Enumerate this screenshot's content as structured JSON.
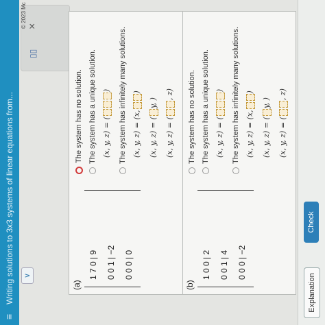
{
  "header": {
    "menu_icon": "hamburger-icon",
    "title": "Writing solutions to 3x3 systems of linear equations from..."
  },
  "chevron_label": "∨",
  "toolbar": {
    "grid_icon": "▯▯",
    "close": "×"
  },
  "copyright": "© 2023 Mc",
  "part_a": {
    "label": "(a)",
    "matrix_rows": [
      "1  7  0  |  9",
      "0  0  1  |  −2",
      "0  0  0  |  0"
    ],
    "options": [
      {
        "text": "The system has no solution.",
        "selected": true
      },
      {
        "text": "The system has a unique solution.",
        "selected": false
      },
      {
        "text": "The system has infinitely many solutions.",
        "selected": false
      }
    ],
    "unique_expr": "(x, y, z) = (",
    "infinite_exprs": [
      "(x, y, z) = (x,",
      "(x, y, z) = (",
      "(x, y, z) = ("
    ],
    "infinite_tails": [
      ")",
      "y, )",
      ", z)"
    ]
  },
  "part_b": {
    "label": "(b)",
    "matrix_rows": [
      "1  0  0  |  2",
      "0  0  1  |  4",
      "0  0  0  |  −2"
    ],
    "options": [
      {
        "text": "The system has no solution.",
        "selected": false
      },
      {
        "text": "The system has a unique solution.",
        "selected": false
      },
      {
        "text": "The system has infinitely many solutions.",
        "selected": false
      }
    ],
    "unique_expr": "(x, y, z) = (",
    "infinite_exprs": [
      "(x, y, z) = (x,",
      "(x, y, z) = (",
      "(x, y, z) = ("
    ],
    "infinite_tails": [
      ")",
      "y, )",
      ", z)"
    ]
  },
  "footer": {
    "explanation": "Explanation",
    "check": "Check"
  }
}
